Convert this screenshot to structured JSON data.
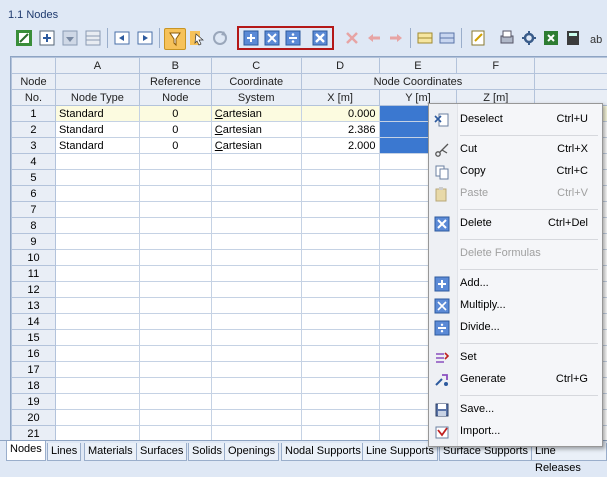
{
  "window": {
    "title": "1.1 Nodes"
  },
  "columns": {
    "letters": [
      "A",
      "B",
      "C",
      "D",
      "E",
      "F"
    ],
    "node_no_line1": "Node",
    "node_no_line2": "No.",
    "a_line2": "Node Type",
    "b_line1": "Reference",
    "b_line2": "Node",
    "c_line1": "Coordinate",
    "c_line2": "System",
    "coords_group": "Node Coordinates",
    "d_line2": "X [m]",
    "e_line2": "Y [m]",
    "f_line2": "Z [m]"
  },
  "rows": [
    {
      "no": "1",
      "type": "Standard",
      "ref": "0",
      "system": "Cartesian",
      "x": "0.000",
      "y": "",
      "z": ""
    },
    {
      "no": "2",
      "type": "Standard",
      "ref": "0",
      "system": "Cartesian",
      "x": "2.386",
      "y": "2",
      "z": ""
    },
    {
      "no": "3",
      "type": "Standard",
      "ref": "0",
      "system": "Cartesian",
      "x": "2.000",
      "y": "-",
      "z": ""
    },
    {
      "no": "4"
    },
    {
      "no": "5"
    },
    {
      "no": "6"
    },
    {
      "no": "7"
    },
    {
      "no": "8"
    },
    {
      "no": "9"
    },
    {
      "no": "10"
    },
    {
      "no": "11"
    },
    {
      "no": "12"
    },
    {
      "no": "13"
    },
    {
      "no": "14"
    },
    {
      "no": "15"
    },
    {
      "no": "16"
    },
    {
      "no": "17"
    },
    {
      "no": "18"
    },
    {
      "no": "19"
    },
    {
      "no": "20"
    },
    {
      "no": "21"
    }
  ],
  "context_menu": {
    "deselect": {
      "label": "Deselect",
      "shortcut": "Ctrl+U"
    },
    "cut": {
      "label": "Cut",
      "shortcut": "Ctrl+X"
    },
    "copy": {
      "label": "Copy",
      "shortcut": "Ctrl+C"
    },
    "paste": {
      "label": "Paste",
      "shortcut": "Ctrl+V"
    },
    "delete": {
      "label": "Delete",
      "shortcut": "Ctrl+Del"
    },
    "delete_formulas": {
      "label": "Delete Formulas"
    },
    "add": {
      "label": "Add..."
    },
    "multiply": {
      "label": "Multiply..."
    },
    "divide": {
      "label": "Divide..."
    },
    "set": {
      "label": "Set"
    },
    "generate": {
      "label": "Generate",
      "shortcut": "Ctrl+G"
    },
    "save": {
      "label": "Save..."
    },
    "import": {
      "label": "Import..."
    }
  },
  "tabs": [
    "Nodes",
    "Lines",
    "Materials",
    "Surfaces",
    "Solids",
    "Openings",
    "Nodal Supports",
    "Line Supports",
    "Surface Supports",
    "Line Releases"
  ],
  "active_tab": "Nodes",
  "colors": {
    "selection": "#3b78d0",
    "highlight_row": "#fcfbe0",
    "toolbar_group_border": "#b41818"
  }
}
